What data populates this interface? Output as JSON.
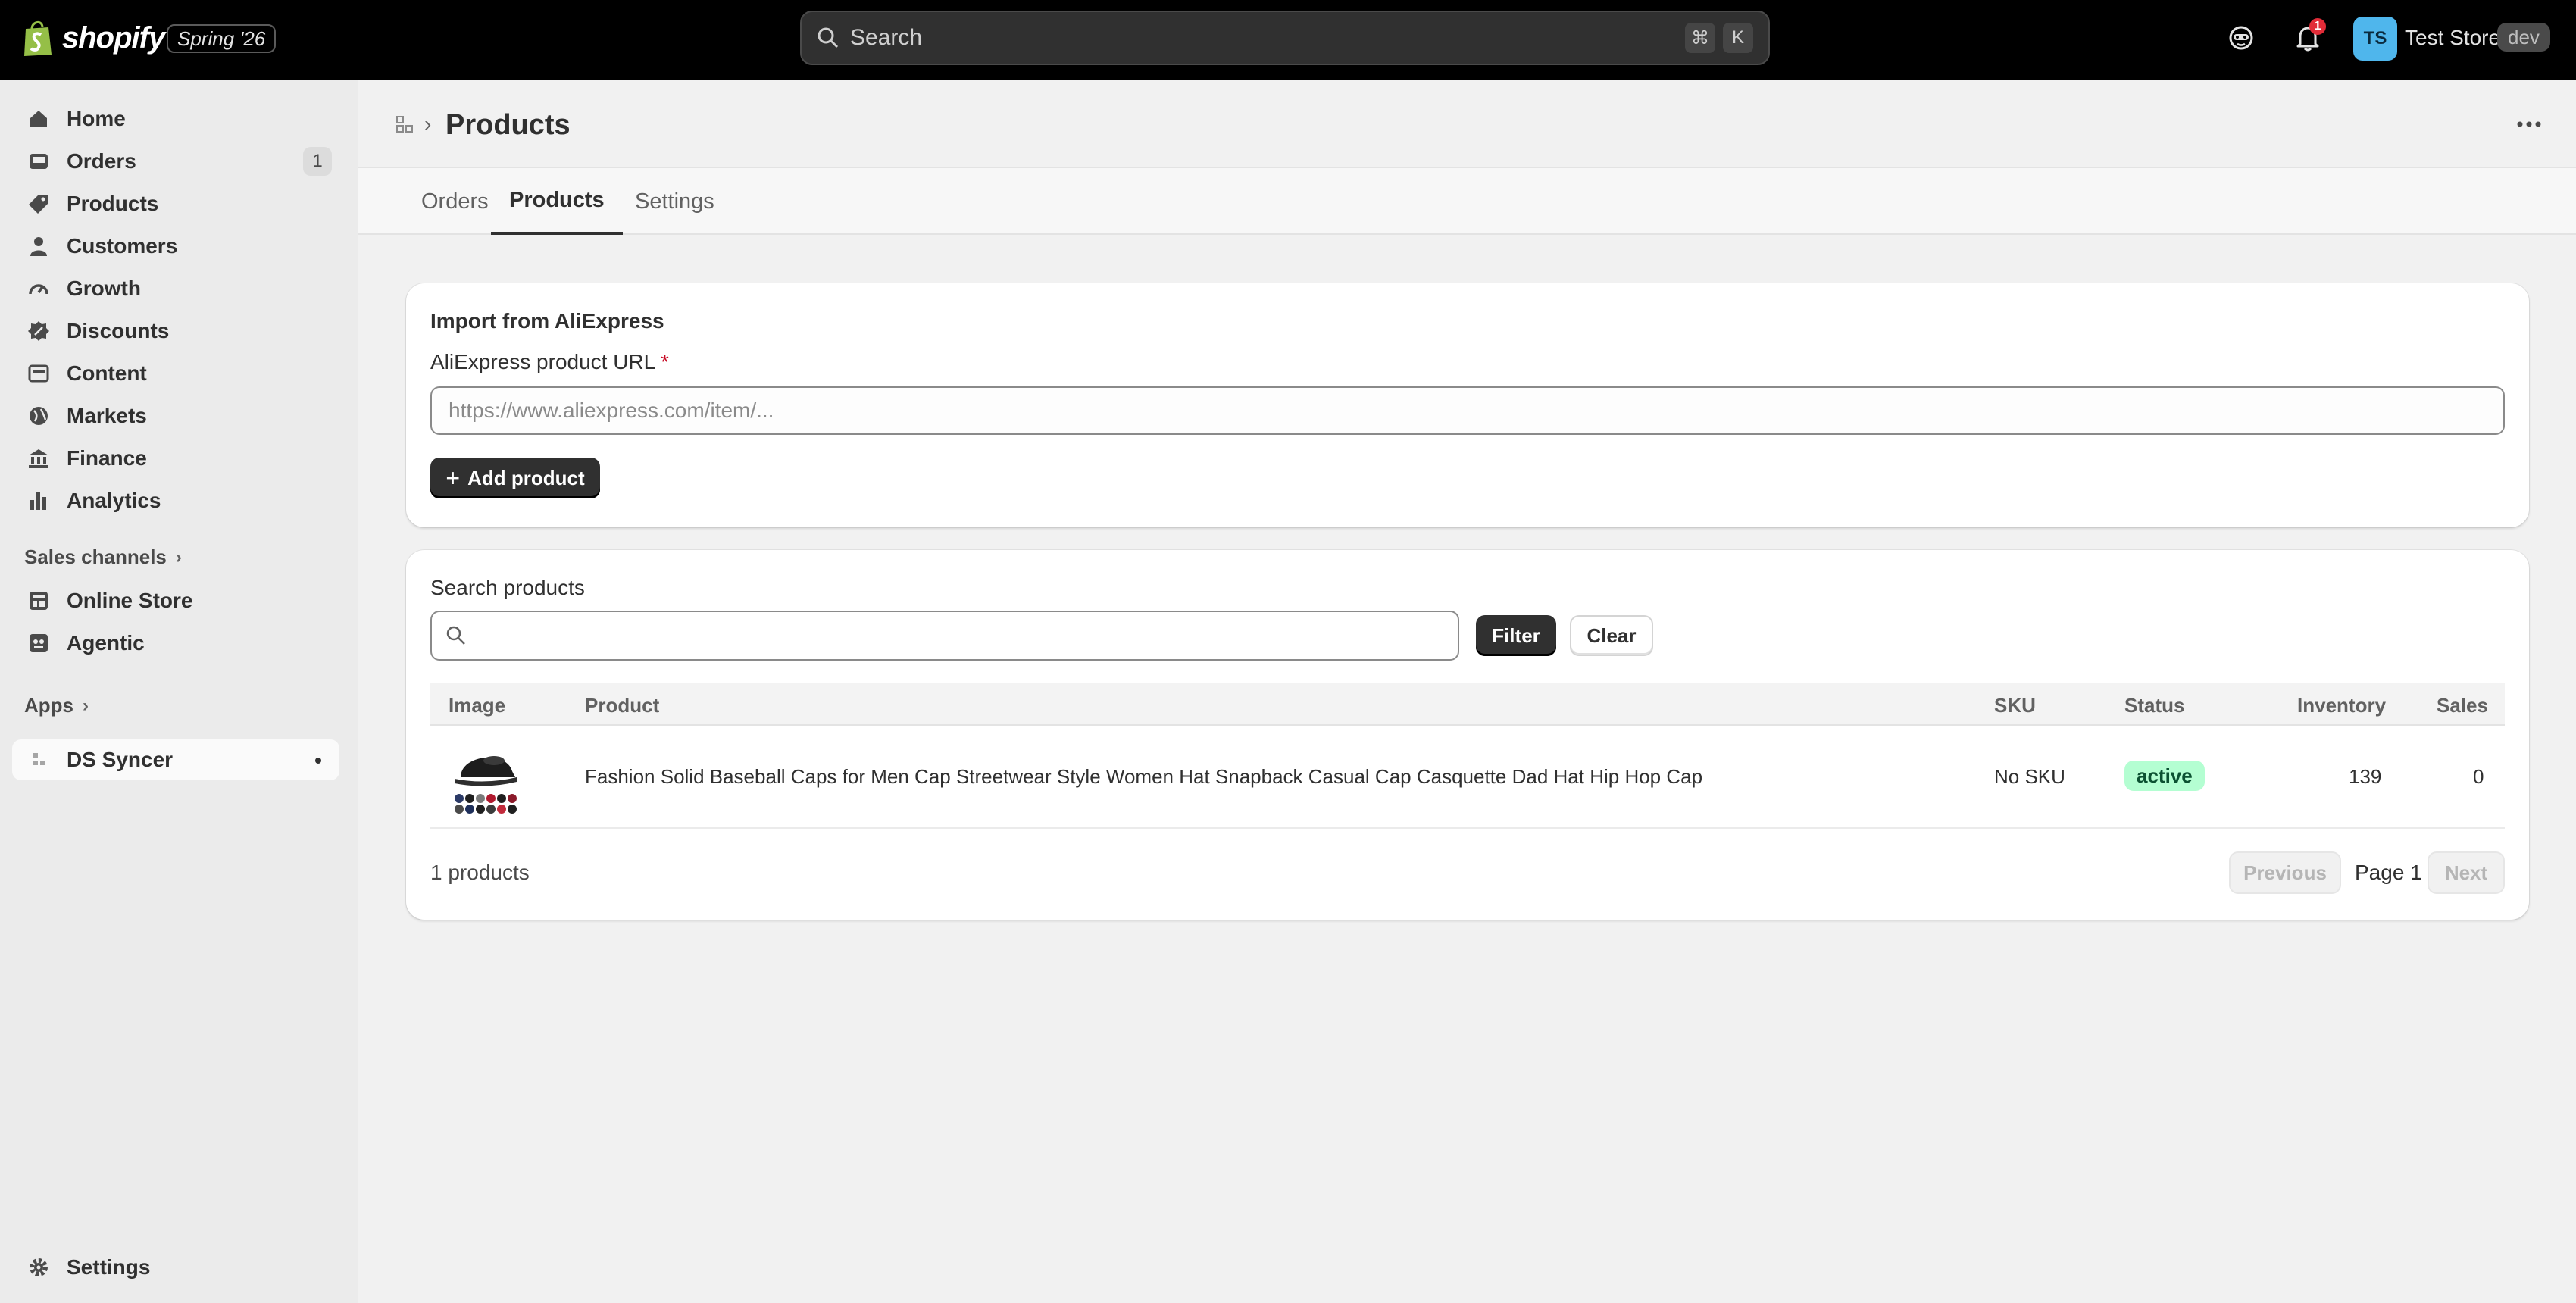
{
  "topbar": {
    "logo_text": "shopify",
    "release_badge": "Spring '26",
    "search_placeholder": "Search",
    "shortcut_keys": [
      "⌘",
      "K"
    ],
    "notification_count": "1",
    "avatar_initials": "TS",
    "store_name": "Test Store",
    "env_badge": "dev"
  },
  "sidebar": {
    "items": [
      {
        "label": "Home",
        "icon": "home-icon"
      },
      {
        "label": "Orders",
        "icon": "inbox-icon",
        "count": "1"
      },
      {
        "label": "Products",
        "icon": "tag-icon"
      },
      {
        "label": "Customers",
        "icon": "person-icon"
      },
      {
        "label": "Growth",
        "icon": "gauge-icon"
      },
      {
        "label": "Discounts",
        "icon": "discount-icon"
      },
      {
        "label": "Content",
        "icon": "image-icon"
      },
      {
        "label": "Markets",
        "icon": "globe-icon"
      },
      {
        "label": "Finance",
        "icon": "bank-icon"
      },
      {
        "label": "Analytics",
        "icon": "bar-chart-icon"
      }
    ],
    "sales_channels_label": "Sales channels",
    "channels": [
      {
        "label": "Online Store",
        "icon": "store-icon"
      },
      {
        "label": "Agentic",
        "icon": "robot-icon"
      }
    ],
    "apps_label": "Apps",
    "apps": [
      {
        "label": "DS Syncer",
        "icon": "app-icon"
      }
    ],
    "settings_label": "Settings"
  },
  "header": {
    "title": "Products"
  },
  "tabs": [
    {
      "label": "Orders"
    },
    {
      "label": "Products"
    },
    {
      "label": "Settings"
    }
  ],
  "import_card": {
    "title": "Import from AliExpress",
    "field_label": "AliExpress product URL",
    "required_mark": "*",
    "url_placeholder": "https://www.aliexpress.com/item/...",
    "url_value": "",
    "add_button": "Add product"
  },
  "products_card": {
    "title": "Search products",
    "search_value": "",
    "filter_button": "Filter",
    "clear_button": "Clear",
    "columns": [
      "Image",
      "Product",
      "SKU",
      "Status",
      "Inventory",
      "Sales"
    ],
    "rows": [
      {
        "product": "Fashion Solid Baseball Caps for Men Cap Streetwear Style Women Hat Snapback Casual Cap Casquette Dad Hat Hip Hop Cap",
        "sku": "No SKU",
        "status": "active",
        "inventory": "139",
        "sales": "0"
      }
    ],
    "count_text": "1 products",
    "prev_button": "Previous",
    "page_text": "Page 1",
    "next_button": "Next"
  },
  "colors": {
    "topbar_bg": "#000000",
    "active_badge_bg": "#b4fed2",
    "primary_button": "#303030",
    "notification": "#e22c38",
    "avatar": "#4fb6ec"
  }
}
